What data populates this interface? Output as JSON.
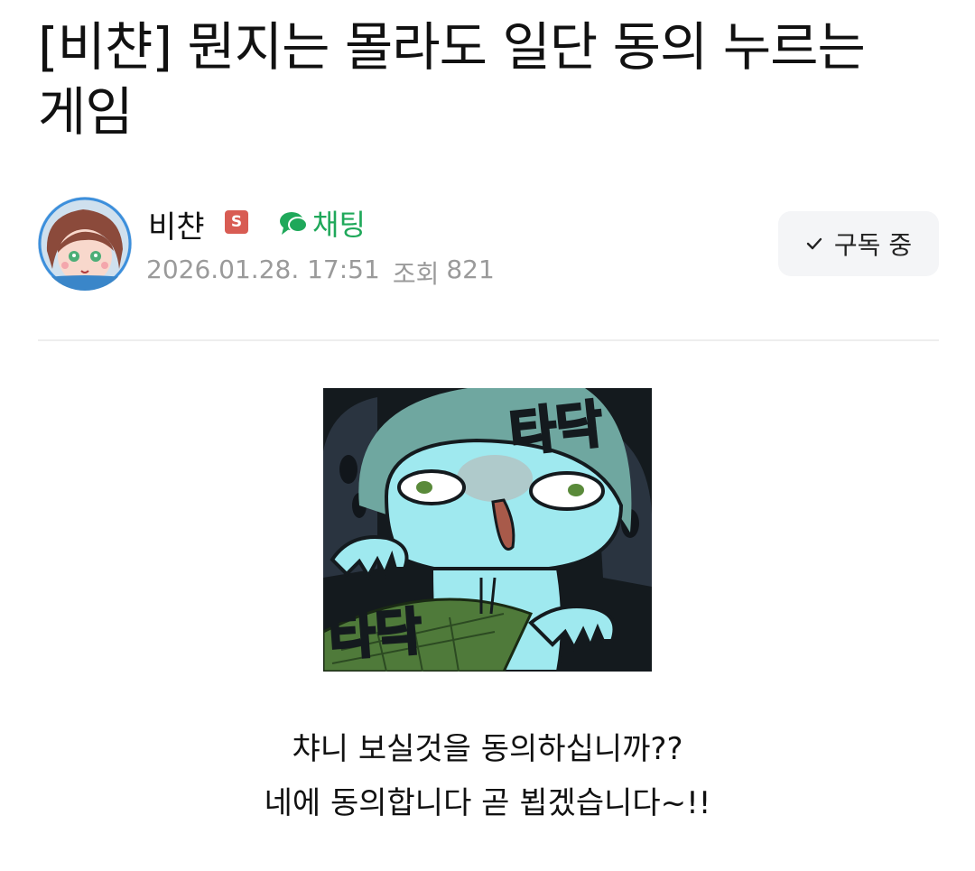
{
  "post": {
    "title": "[비챤] 뭔지는 몰라도 일단 동의 누르는 게임",
    "author": {
      "name": "비챤",
      "badge": "S",
      "chat_label": "채팅"
    },
    "date": "2026.01.28. 17:51",
    "views_label": "조회",
    "views": "821",
    "subscribe_label": "구독 중",
    "sticker": {
      "caption_top": "타닥",
      "caption_bottom": "타닥"
    },
    "body_lines": [
      "챠니 보실것을 동의하십니까??",
      "네에 동의합니다 곧 뵙겠습니다~!!"
    ]
  },
  "colors": {
    "chat_green": "#1fa85a",
    "badge_red": "#d85c53",
    "meta_gray": "#9a9a9a",
    "button_bg": "#f4f5f7"
  },
  "icons": {
    "chat": "speech-bubble-icon",
    "subscribe": "checkmark-icon"
  }
}
